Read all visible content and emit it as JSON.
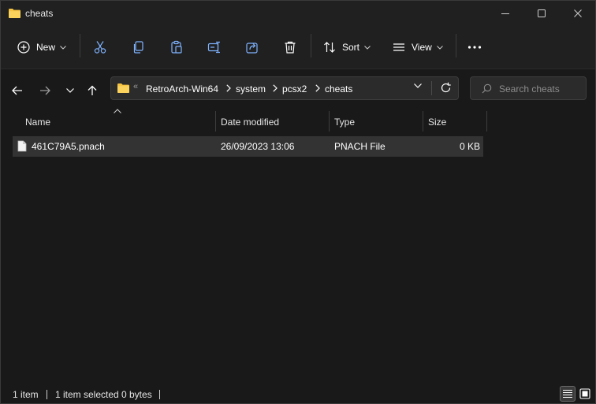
{
  "window": {
    "title": "cheats"
  },
  "toolbar": {
    "new_label": "New",
    "sort_label": "Sort",
    "view_label": "View"
  },
  "address": {
    "overflow": "«",
    "crumbs": [
      "RetroArch-Win64",
      "system",
      "pcsx2",
      "cheats"
    ]
  },
  "search": {
    "placeholder": "Search cheats"
  },
  "columns": {
    "name": "Name",
    "date": "Date modified",
    "type": "Type",
    "size": "Size"
  },
  "files": [
    {
      "name": "461C79A5.pnach",
      "date": "26/09/2023 13:06",
      "type": "PNACH File",
      "size": "0 KB"
    }
  ],
  "status": {
    "count": "1 item",
    "selection": "1 item selected",
    "size": "0 bytes"
  },
  "colors": {
    "background": "#191919",
    "chrome": "#202020",
    "selection": "#333333",
    "folder": "#f6c343"
  }
}
